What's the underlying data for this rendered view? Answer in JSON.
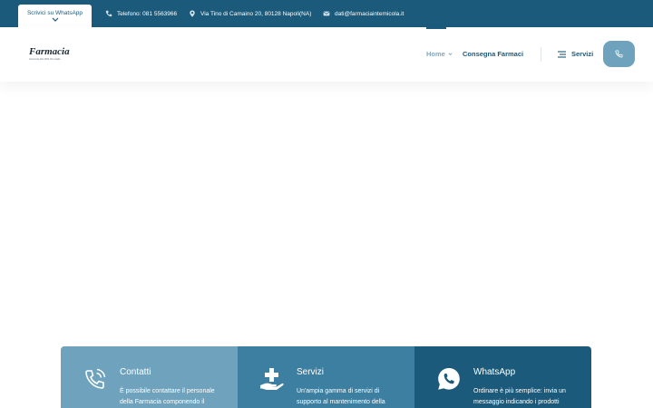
{
  "topbar": {
    "whatsapp_tab": "Scrivici su WhatsApp",
    "phone": "Telefono: 081 5563966",
    "address": "Via Tino di Camaino 20, 80128 Napoli(NA)",
    "email": "dati@farmaciaintemicola.it"
  },
  "header": {
    "logo_text": "Farmacia",
    "logo_tagline": "Intemicola      Dal 1993 Jitto Giallo",
    "nav": {
      "home": "Home",
      "consegna": "Consegna Farmaci",
      "servizi": "Servizi"
    }
  },
  "cards": [
    {
      "title": "Contatti",
      "text": "È possibile contattare il personale della Farmacia componendo il",
      "icon": "phone-ring-icon",
      "color": "#6fa3bd"
    },
    {
      "title": "Servizi",
      "text": "Un'ampia gamma di servizi di supporto al mantenimento della",
      "icon": "hand-cross-icon",
      "color": "#3c7fa0"
    },
    {
      "title": "WhatsApp",
      "text": "Ordinare è più semplice: invia un messaggio indicando i prodotti",
      "icon": "whatsapp-icon",
      "color": "#1b5a7a"
    }
  ],
  "colors": {
    "brand_dark": "#1b5a7a",
    "brand_light": "#6fa3bd",
    "nav_muted": "#7fa7bf"
  }
}
